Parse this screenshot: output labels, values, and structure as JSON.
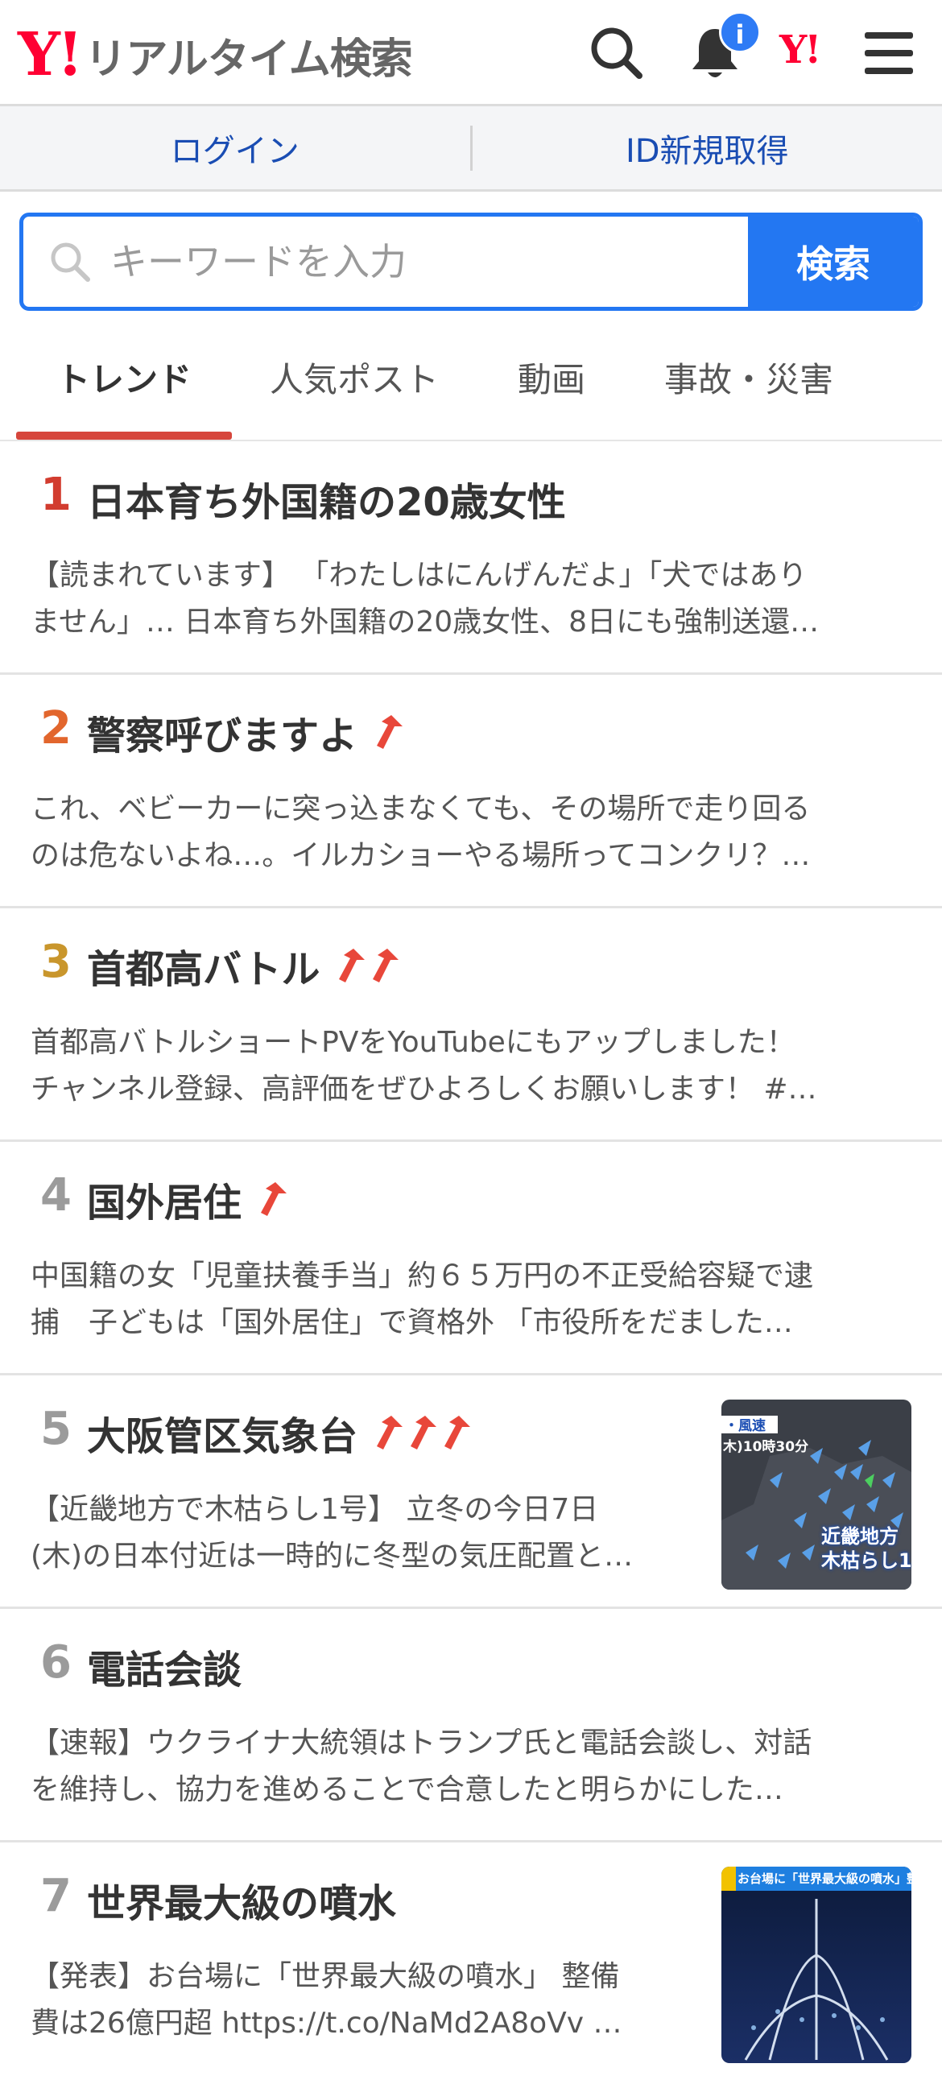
{
  "header": {
    "logo_mark": "Y!",
    "logo_text": "リアルタイム検索",
    "notification_badge": "i",
    "yahoo_mark": "Y!"
  },
  "auth": {
    "login": "ログイン",
    "signup": "ID新規取得"
  },
  "search": {
    "placeholder": "キーワードを入力",
    "button": "検索"
  },
  "tabs": [
    "トレンド",
    "人気ポスト",
    "動画",
    "事故・災害"
  ],
  "items": [
    {
      "rank": "1",
      "rank_color": "#d23c2f",
      "title": "日本育ち外国籍の20歳女性",
      "arrows": 0,
      "line1": "【読まれています】 「わたしはにんげんだよ」「犬ではあり",
      "line2": "ません」… 日本育ち外国籍の20歳女性、8日にも強制送還…"
    },
    {
      "rank": "2",
      "rank_color": "#e2662d",
      "title": "警察呼びますよ",
      "arrows": 1,
      "line1": "これ、ベビーカーに突っ込まなくても、その場所で走り回る",
      "line2": "のは危ないよね…。イルカショーやる場所ってコンクリ？…"
    },
    {
      "rank": "3",
      "rank_color": "#c9962c",
      "title": "首都高バトル",
      "arrows": 2,
      "line1": "首都高バトルショートPVをYouTubeにもアップしました！",
      "line2": "チャンネル登録、高評価をぜひよろしくお願いします！ #…"
    },
    {
      "rank": "4",
      "rank_color": "#9b9b9b",
      "title": "国外居住",
      "arrows": 1,
      "line1": "中国籍の女「児童扶養手当」約６５万円の不正受給容疑で逮",
      "line2": "捕　子どもは「国外居住」で資格外 「市役所をだました…"
    },
    {
      "rank": "5",
      "rank_color": "#9b9b9b",
      "title": "大阪管区気象台",
      "arrows": 3,
      "line1": "【近畿地方で木枯らし1号】 立冬の今日7日",
      "line2": "(木)の日本付近は一時的に冬型の気圧配置と…",
      "thumb": {
        "tag": "・風速",
        "time": "木)10時30分",
        "caption1": "近畿地方",
        "caption2": "木枯らし1"
      }
    },
    {
      "rank": "6",
      "rank_color": "#9b9b9b",
      "title": "電話会談",
      "arrows": 0,
      "line1": "【速報】ウクライナ大統領はトランプ氏と電話会談し、対話",
      "line2": "を維持し、協力を進めることで合意したと明らかにした…"
    },
    {
      "rank": "7",
      "rank_color": "#9b9b9b",
      "title": "世界最大級の噴水",
      "arrows": 0,
      "line1": "【発表】お台場に「世界最大級の噴水」 整備",
      "line2": "費は26億円超 https://t.co/NaMd2A8oVv …",
      "thumb": {
        "banner": "お台場に「世界最大級の噴水」整備"
      }
    }
  ]
}
